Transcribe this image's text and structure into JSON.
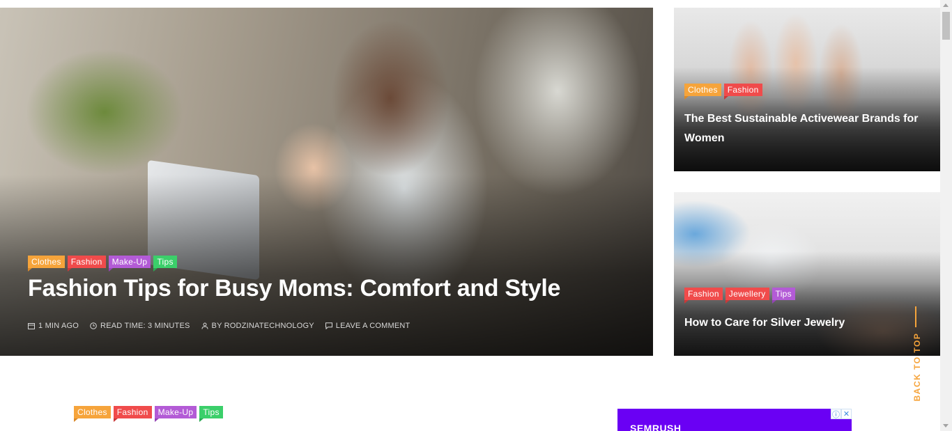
{
  "hero": {
    "tags": [
      "Clothes",
      "Fashion",
      "Make-Up",
      "Tips"
    ],
    "title": "Fashion Tips for Busy Moms: Comfort and Style",
    "meta": {
      "date": "1 MIN AGO",
      "read_time": "READ TIME: 3 MINUTES",
      "author": "BY RODZINATECHNOLOGY",
      "comment": "LEAVE A COMMENT"
    }
  },
  "cards": [
    {
      "tags": [
        "Clothes",
        "Fashion"
      ],
      "title": "The Best Sustainable Activewear Brands for Women"
    },
    {
      "tags": [
        "Fashion",
        "Jewellery",
        "Tips"
      ],
      "title": "How to Care for Silver Jewelry"
    }
  ],
  "lower": {
    "tags": [
      "Clothes",
      "Fashion",
      "Make-Up",
      "Tips"
    ]
  },
  "ad": {
    "brand": "SEMRUSH",
    "info_icon": "info-icon",
    "close_icon": "close-icon"
  },
  "back_to_top": "BACK TO TOP",
  "colors": {
    "clothes": "#f6a43b",
    "fashion": "#f04b4b",
    "makeup": "#b35bd6",
    "tips": "#3bcf6a",
    "accent": "#f6a43b",
    "ad_bg": "#6a00f4"
  }
}
